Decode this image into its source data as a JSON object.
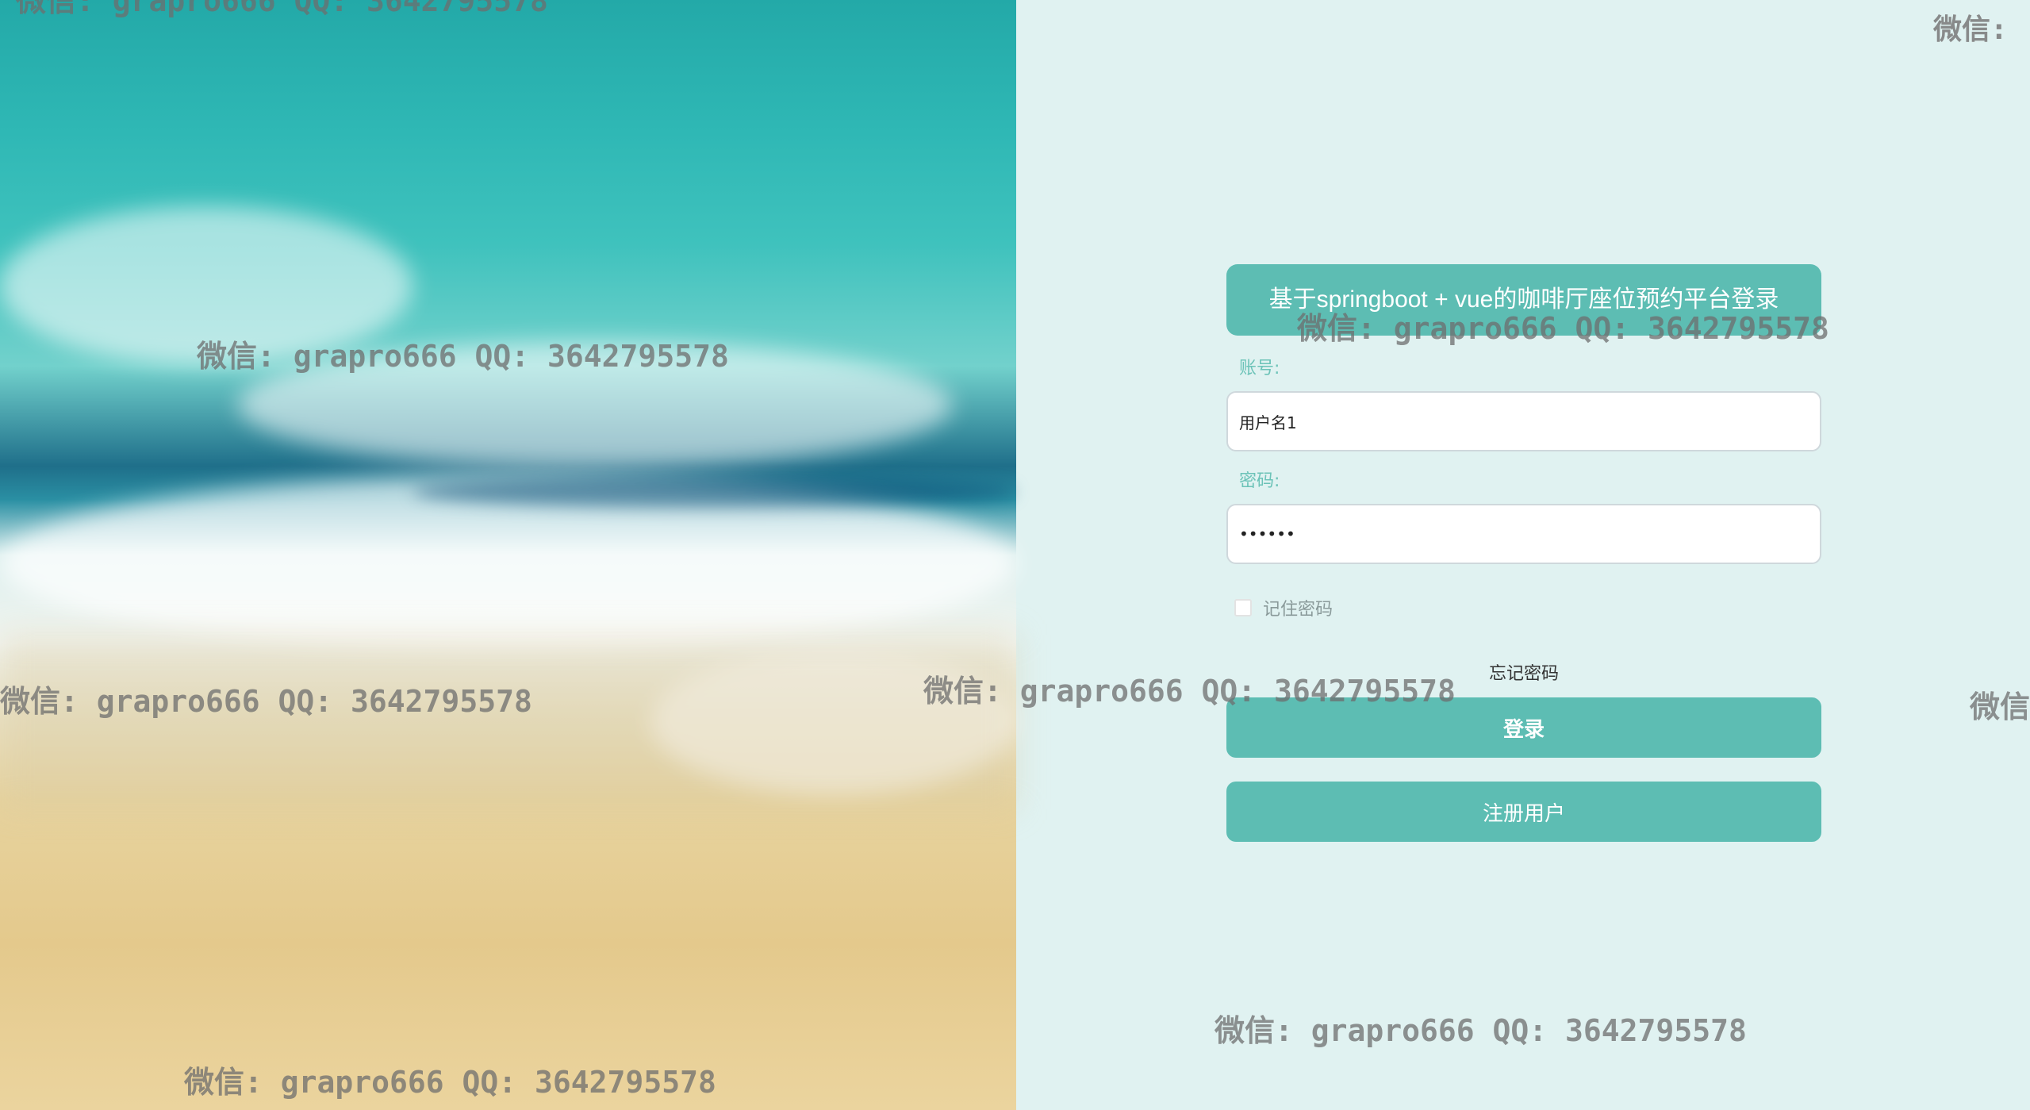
{
  "login": {
    "title": "基于springboot + vue的咖啡厅座位预约平台登录",
    "account_label": "账号:",
    "account_value": "用户名1",
    "password_label": "密码:",
    "password_value": "123456",
    "remember_label": "记住密码",
    "forgot_label": "忘记密码",
    "login_button": "登录",
    "register_button": "注册用户"
  },
  "watermarks": {
    "full": "微信: grapro666 QQ: 3642795578",
    "top_right": "微信:",
    "right_edge": "微信"
  },
  "colors": {
    "accent": "#5dbdb3",
    "page_background": "#e0f2f1",
    "label": "#6cc3b8"
  }
}
